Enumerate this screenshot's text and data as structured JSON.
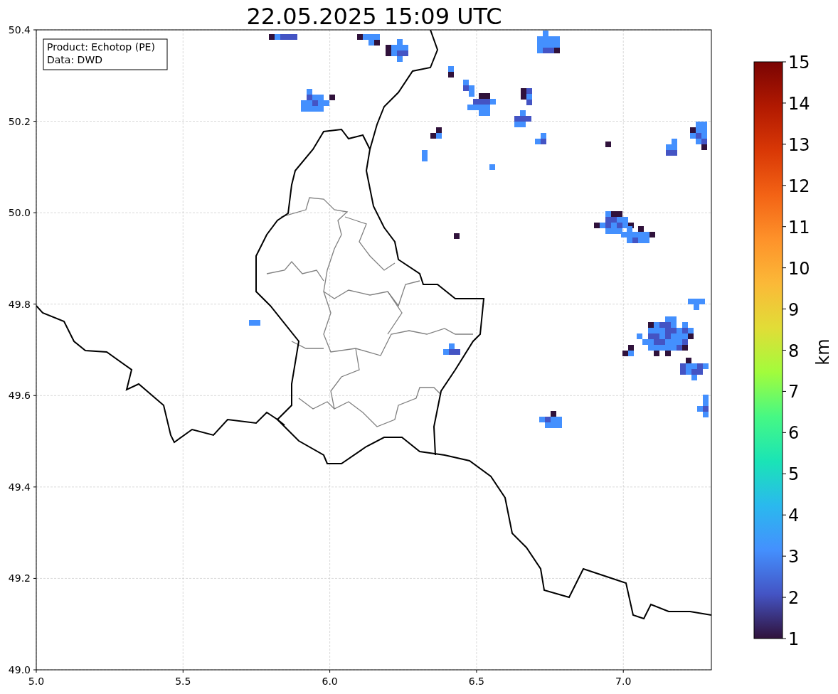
{
  "title": "22.05.2025 15:09 UTC",
  "info_box": {
    "lines": [
      "Product: Echotop (PE)",
      "Data: DWD"
    ]
  },
  "map": {
    "kind": "map",
    "xticks": [
      "5.0",
      "5.5",
      "6.0",
      "6.5",
      "7.0"
    ],
    "yticks": [
      "50.4",
      "50.2",
      "50.0",
      "49.8",
      "49.6",
      "49.4",
      "49.2",
      "49.0"
    ]
  },
  "colorbar": {
    "ticks": [
      "15",
      "14",
      "13",
      "12",
      "11",
      "10",
      "9",
      "8",
      "7",
      "6",
      "5",
      "4",
      "3",
      "2",
      "1"
    ],
    "label": "km"
  }
}
